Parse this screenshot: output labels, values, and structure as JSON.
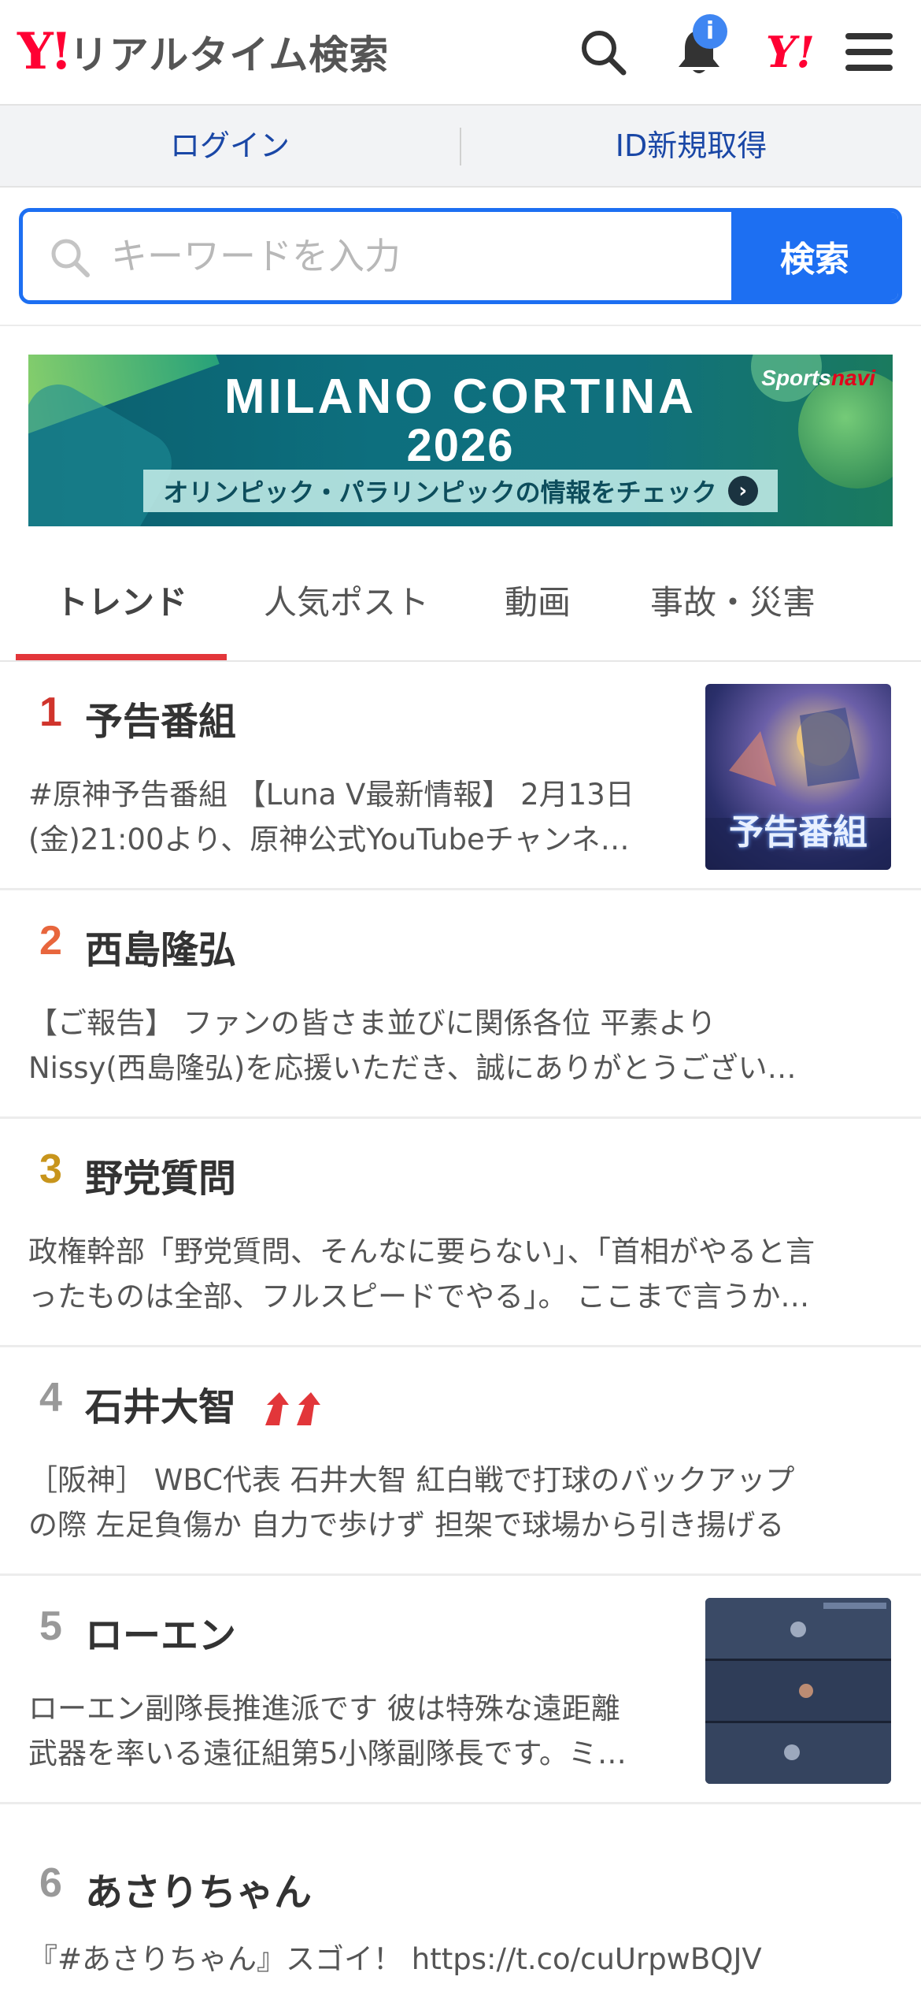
{
  "header": {
    "logo_mark": "Y!",
    "logo_text": "リアルタイム検索",
    "notification_count": "i",
    "yahoo_mark": "Y!"
  },
  "auth": {
    "login": "ログイン",
    "signup": "ID新規取得"
  },
  "search": {
    "placeholder": "キーワードを入力",
    "button": "検索"
  },
  "banner": {
    "title_line1": "MILANO CORTINA",
    "title_line2": "2026",
    "cta": "オリンピック・パラリンピックの情報をチェック",
    "brand_a": "Sports",
    "brand_b": "navi"
  },
  "tabs": [
    {
      "label": "トレンド",
      "active": true
    },
    {
      "label": "人気ポスト",
      "active": false
    },
    {
      "label": "動画",
      "active": false
    },
    {
      "label": "事故・災害",
      "active": false
    }
  ],
  "trends": [
    {
      "rank": "1",
      "rank_color": "#d0342c",
      "keyword": "予告番組",
      "line1": "#原神予告番組 【Luna V最新情報】 2月13日",
      "line2": "(金)21:00より、原神公式YouTubeチャンネ…",
      "thumb_text": "予告番組"
    },
    {
      "rank": "2",
      "rank_color": "#e8663d",
      "keyword": "西島隆弘",
      "line1": "【ご報告】 ファンの皆さま並びに関係各位 平素より",
      "line2": "Nissy(西島隆弘)を応援いただき、誠にありがとうござい…"
    },
    {
      "rank": "3",
      "rank_color": "#c8951c",
      "keyword": "野党質問",
      "line1": "政権幹部「野党質問、そんなに要らない」、「首相がやると言",
      "line2": "ったものは全部、フルスピードでやる」。 ここまで言うか…"
    },
    {
      "rank": "4",
      "rank_color": "#999999",
      "keyword": "石井大智",
      "line1": "［阪神］ WBC代表 石井大智 紅白戦で打球のバックアップ",
      "line2": "の際 左足負傷か 自力で歩けず 担架で球場から引き揚げる"
    },
    {
      "rank": "5",
      "rank_color": "#999999",
      "keyword": "ローエン",
      "line1": "ローエン副隊長推進派です 彼は特殊な遠距離",
      "line2": "武器を率いる遠征組第5小隊副隊長です。ミ…"
    },
    {
      "rank": "6",
      "rank_color": "#999999",
      "keyword": "あさりちゃん",
      "line1": "『#あさりちゃん』スゴイ！ https://t.co/cuUrpwBQJV",
      "line2": ""
    }
  ]
}
